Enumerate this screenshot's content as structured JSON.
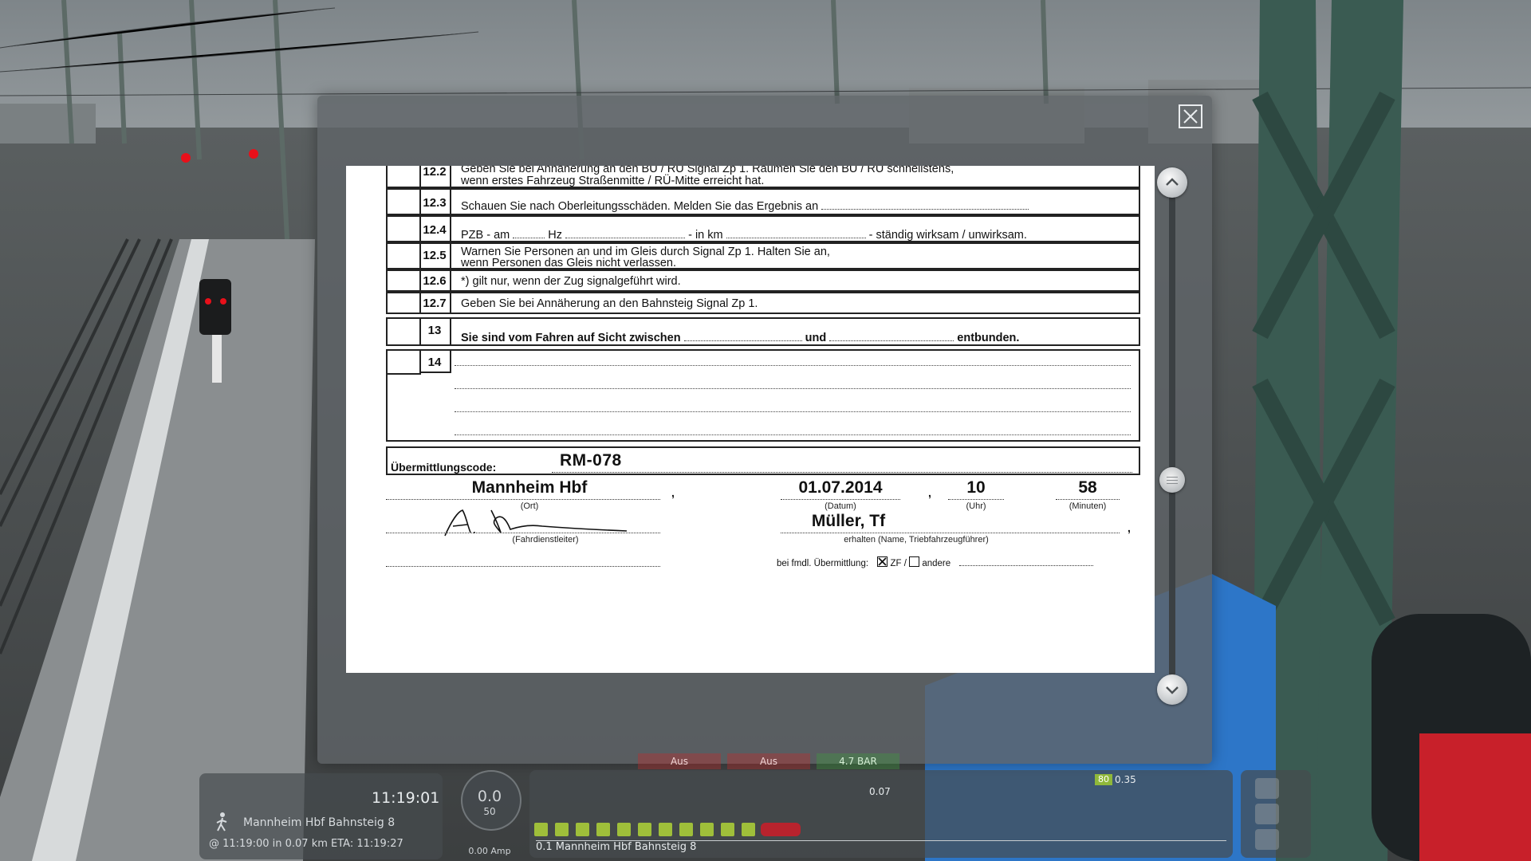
{
  "dialog": {
    "close_icon": "close-icon",
    "scroll_up_icon": "chevron-up-icon",
    "scroll_down_icon": "chevron-down-icon",
    "scroll_position": 0.6
  },
  "document": {
    "rows": [
      {
        "num": "12.2",
        "line1": "Geben Sie bei Annäherung  an den BÜ / RÜ Signal Zp 1. Räumen Sie den BÜ / RÜ schnellstens,",
        "line2": "wenn erstes Fahrzeug Straßenmitte / RÜ-Mitte erreicht hat."
      },
      {
        "num": "12.3",
        "line1": "Schauen Sie nach Oberleitungsschäden. Melden Sie das Ergebnis an"
      },
      {
        "num": "12.4",
        "line1": "PZB  -  am",
        "part2": "Hz",
        "part3": "- in km",
        "part4": "- ständig  wirksam  / unwirksam."
      },
      {
        "num": "12.5",
        "line1": "Warnen Sie Personen  an und im Gleis durch Signal Zp 1. Halten Sie an,",
        "line2": "wenn Personen das Gleis nicht verlassen."
      },
      {
        "num": "12.6",
        "line1": "*) gilt nur, wenn der Zug signalgeführt  wird."
      },
      {
        "num": "12.7",
        "line1": "Geben Sie bei Annäherung  an den Bahnsteig Signal Zp 1."
      },
      {
        "num": "13",
        "part1": "Sie sind vom Fahren auf Sicht zwischen",
        "part2": "und",
        "part3": "entbunden."
      },
      {
        "num": "14"
      }
    ],
    "transmission_label": "Übermittlungscode:",
    "transmission_code": "RM-078",
    "location": "Mannheim Hbf",
    "location_caption": "(Ort)",
    "date": "01.07.2014",
    "date_caption": "(Datum)",
    "hour": "10",
    "hour_caption": "(Uhr)",
    "minutes": "58",
    "minutes_caption": "(Minuten)",
    "dispatcher_caption": "(Fahrdienstleiter)",
    "receiver_name": "Müller, Tf",
    "receiver_caption": "erhalten (Name, Triebfahrzeugführer)",
    "remote_label": "bei fmdl. Übermittlung:",
    "option_zf": "ZF /",
    "option_zf_checked": true,
    "option_other": "andere"
  },
  "hud": {
    "clock": "11:19:01",
    "next_station": "Mannheim Hbf Bahnsteig 8",
    "arrival": "@  11:19:00  in  0.07 km     ETA:  11:19:27",
    "speed": "0.0",
    "speed_limit": "50",
    "amperage": "0.00 Amp",
    "track_label": "0.1 Mannheim Hbf Bahnsteig 8",
    "marker_distance": "0.07",
    "limit_badge": "80",
    "limit_distance": "0.35",
    "indicator_left": "Aus",
    "indicator_mid": "Aus",
    "indicator_pressure": "4.7 BAR"
  },
  "colors": {
    "dialog_overlay": "#5f6468",
    "document_bg": "#ffffff",
    "hud_green": "#9fbf3a",
    "signal_red": "#e8101a"
  }
}
